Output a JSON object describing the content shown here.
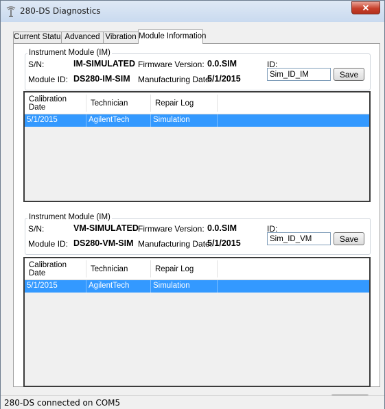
{
  "window": {
    "title": "280-DS Diagnostics",
    "close_label": "✕"
  },
  "tabs": [
    {
      "label": "Current Status"
    },
    {
      "label": "Advanced"
    },
    {
      "label": "Vibration"
    },
    {
      "label": "Module Information",
      "active": true
    }
  ],
  "modules": [
    {
      "group_title": "Instrument Module (IM)",
      "sn_label": "S/N:",
      "sn_value": "IM-SIMULATED",
      "firmware_label": "Firmware Version:",
      "firmware_value": "0.0.SIM",
      "id_label": "ID:",
      "id_value": "Sim_ID_IM",
      "module_id_label": "Module ID:",
      "module_id_value": "DS280-IM-SIM",
      "mfg_label": "Manufacturing Date:",
      "mfg_value": "5/1/2015",
      "save_label": "Save",
      "table": {
        "columns": [
          "Calibration\nDate",
          "Technician",
          "Repair Log"
        ],
        "rows": [
          [
            "5/1/2015",
            "AgilentTech",
            "Simulation"
          ]
        ]
      }
    },
    {
      "group_title": "Instrument Module (IM)",
      "sn_label": "S/N:",
      "sn_value": "VM-SIMULATED",
      "firmware_label": "Firmware Version:",
      "firmware_value": "0.0.SIM",
      "id_label": "ID:",
      "id_value": "Sim_ID_VM",
      "module_id_label": "Module ID:",
      "module_id_value": "DS280-VM-SIM",
      "mfg_label": "Manufacturing Date:",
      "mfg_value": "5/1/2015",
      "save_label": "Save",
      "table": {
        "columns": [
          "Calibration\nDate",
          "Technician",
          "Repair Log"
        ],
        "rows": [
          [
            "5/1/2015",
            "AgilentTech",
            "Simulation"
          ]
        ]
      }
    }
  ],
  "next_button_label": ">>",
  "status_text": "280-DS connected on COM5",
  "colors": {
    "selection": "#3399ff",
    "close": "#c7402b"
  }
}
